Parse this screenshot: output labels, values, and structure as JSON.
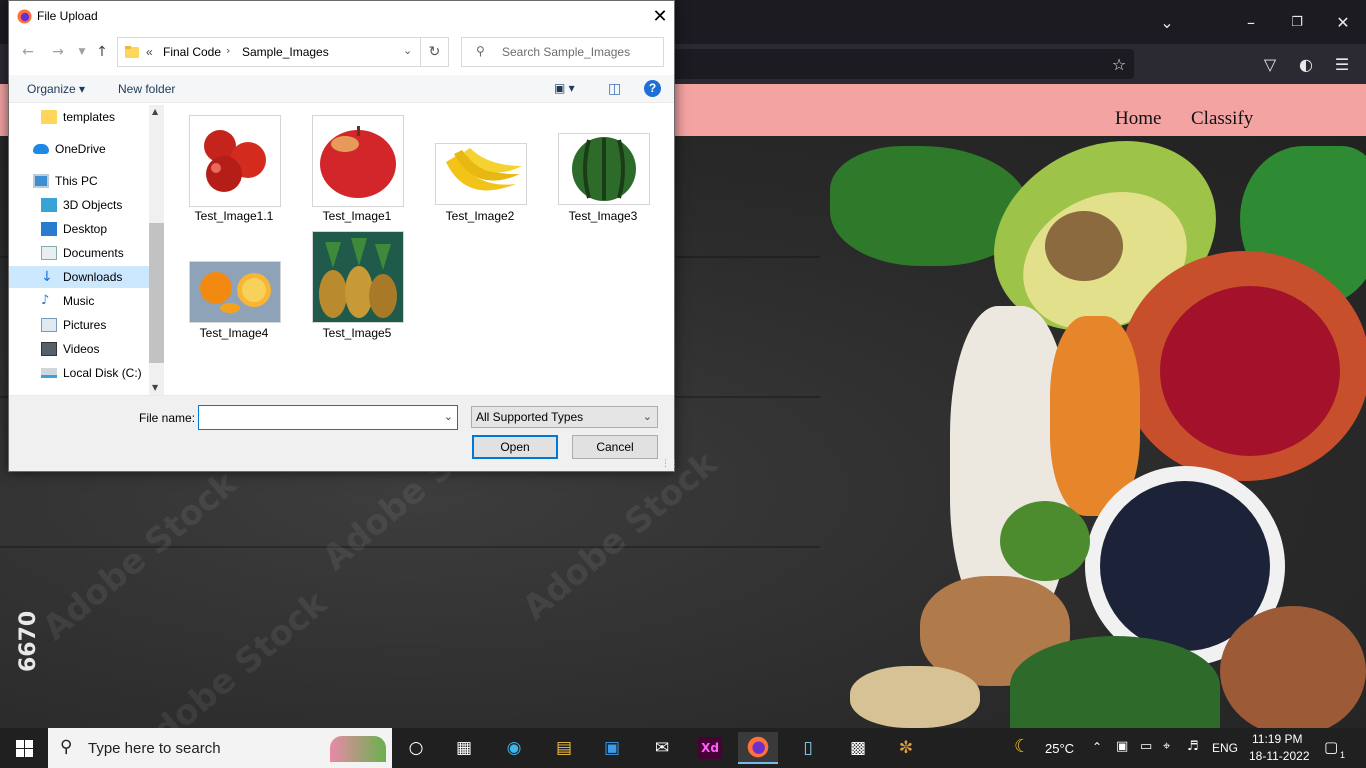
{
  "dialog": {
    "title": "File Upload",
    "breadcrumb": {
      "overflow": "«",
      "parts": [
        "Final Code",
        "Sample_Images"
      ]
    },
    "search_placeholder": "Search Sample_Images",
    "organize_label": "Organize",
    "new_folder_label": "New folder",
    "nav_items": [
      {
        "label": "templates",
        "icon": "folder-icon"
      },
      {
        "label": "OneDrive",
        "icon": "cloud-icon"
      },
      {
        "label": "This PC",
        "icon": "computer-icon"
      },
      {
        "label": "3D Objects",
        "icon": "cube-icon"
      },
      {
        "label": "Desktop",
        "icon": "desktop-icon"
      },
      {
        "label": "Documents",
        "icon": "document-icon"
      },
      {
        "label": "Downloads",
        "icon": "download-icon",
        "selected": true
      },
      {
        "label": "Music",
        "icon": "music-icon"
      },
      {
        "label": "Pictures",
        "icon": "pictures-icon"
      },
      {
        "label": "Videos",
        "icon": "video-icon"
      },
      {
        "label": "Local Disk (C:)",
        "icon": "disk-icon"
      }
    ],
    "files": [
      {
        "name": "Test_Image1.1",
        "kind": "apples"
      },
      {
        "name": "Test_Image1",
        "kind": "apple"
      },
      {
        "name": "Test_Image2",
        "kind": "bananas"
      },
      {
        "name": "Test_Image3",
        "kind": "watermelon"
      },
      {
        "name": "Test_Image4",
        "kind": "oranges"
      },
      {
        "name": "Test_Image5",
        "kind": "pineapples"
      }
    ],
    "file_name_label": "File name:",
    "file_name_value": "",
    "file_type": "All Supported Types",
    "open_label": "Open",
    "cancel_label": "Cancel"
  },
  "site": {
    "nav": [
      "Home",
      "Classify"
    ],
    "side_number": "6670",
    "watermark": "Adobe Stock"
  },
  "taskbar": {
    "search_placeholder": "Type here to search",
    "weather": "25°C",
    "language": "ENG",
    "time": "11:19 PM",
    "date": "18-11-2022",
    "notification_count": "1"
  },
  "colors": {
    "nav_bg": "#f4a3a3",
    "accent": "#0078d7",
    "selection": "#cce8ff"
  }
}
